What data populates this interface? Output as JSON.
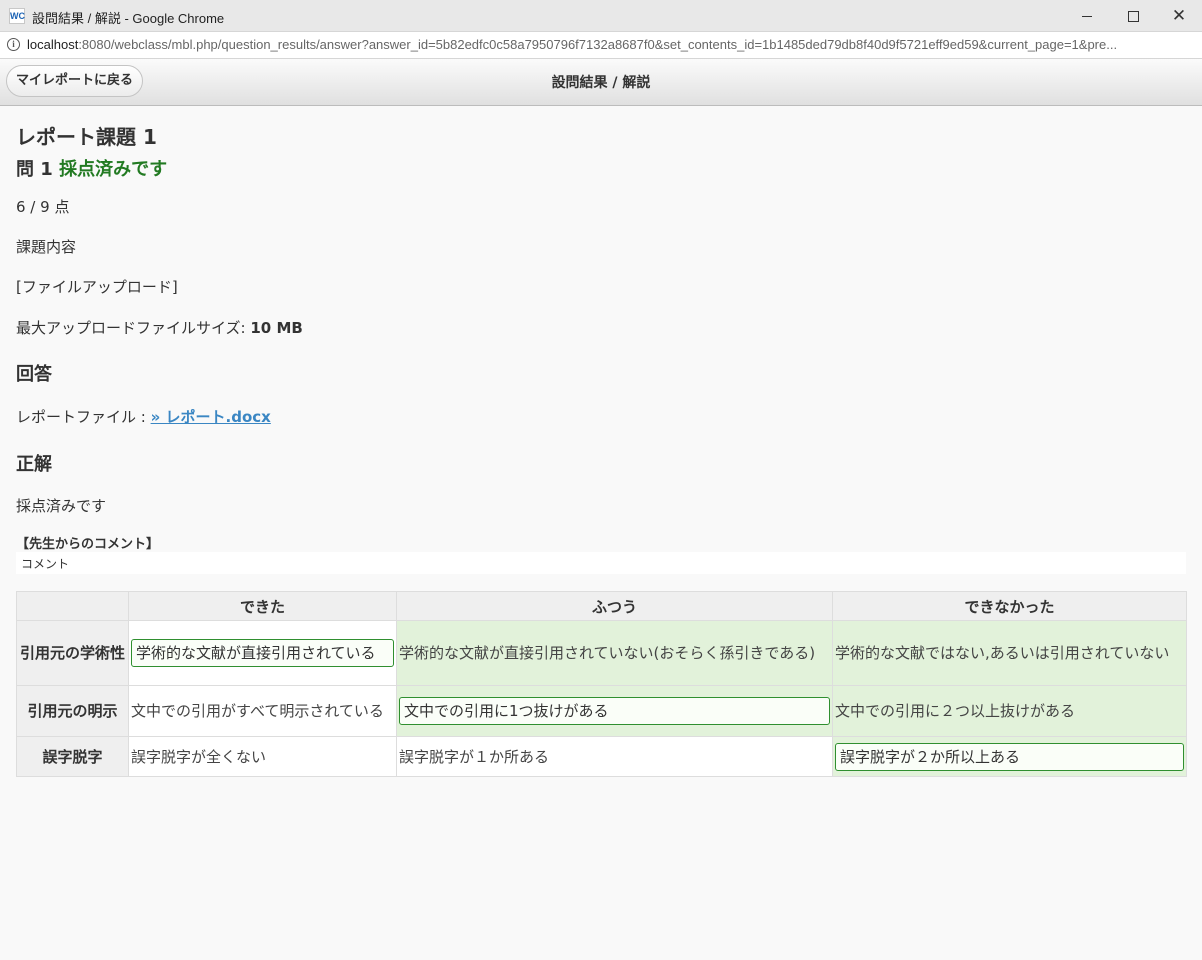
{
  "browser": {
    "window_title": "設問結果 / 解説 - Google Chrome",
    "app_icon": "WC",
    "url_host": "localhost",
    "url_rest": ":8080/webclass/mbl.php/question_results/answer?answer_id=5b82edfc0c58a7950796f7132a8687f0&set_contents_id=1b1485ded79db8f40d9f5721eff9ed59&current_page=1&pre..."
  },
  "header": {
    "back_label": "マイレポートに戻る",
    "title": "設問結果 / 解説"
  },
  "assignment": {
    "title": "レポート課題 1",
    "question_label": "問 1",
    "status": "採点済みです",
    "score": "6 / 9 点",
    "section_label": "課題内容",
    "type_label": "[ファイルアップロード]",
    "max_size_label": "最大アップロードファイルサイズ: ",
    "max_size_value": "10 MB"
  },
  "answer": {
    "heading": "回答",
    "file_label": "レポートファイル : ",
    "file_link": "» レポート.docx"
  },
  "correct": {
    "heading": "正解",
    "text": "採点済みです"
  },
  "comment": {
    "label": "【先生からのコメント】",
    "text": "コメント"
  },
  "rubric": {
    "columns": [
      "できた",
      "ふつう",
      "できなかった"
    ],
    "rows": [
      {
        "criterion": "引用元の学術性",
        "cells": [
          "学術的な文献が直接引用されている",
          "学術的な文献が直接引用されていない(おそらく孫引きである)",
          "学術的な文献ではない,あるいは引用されていない"
        ],
        "selected_index": 0
      },
      {
        "criterion": "引用元の明示",
        "cells": [
          "文中での引用がすべて明示されている",
          "文中での引用に1つ抜けがある",
          "文中での引用に２つ以上抜けがある"
        ],
        "selected_index": 1
      },
      {
        "criterion": "誤字脱字",
        "cells": [
          "誤字脱字が全くない",
          "誤字脱字が１か所ある",
          "誤字脱字が２か所以上ある"
        ],
        "selected_index": 2
      }
    ]
  },
  "icons": {
    "info": "info-icon",
    "minimize": "minimize-icon",
    "maximize": "maximize-icon",
    "close": "close-icon"
  },
  "colors": {
    "status_green": "#227a22",
    "link_blue": "#3a86c3",
    "highlight_green": "#e2f2da",
    "selected_border": "#2f8f2f"
  }
}
